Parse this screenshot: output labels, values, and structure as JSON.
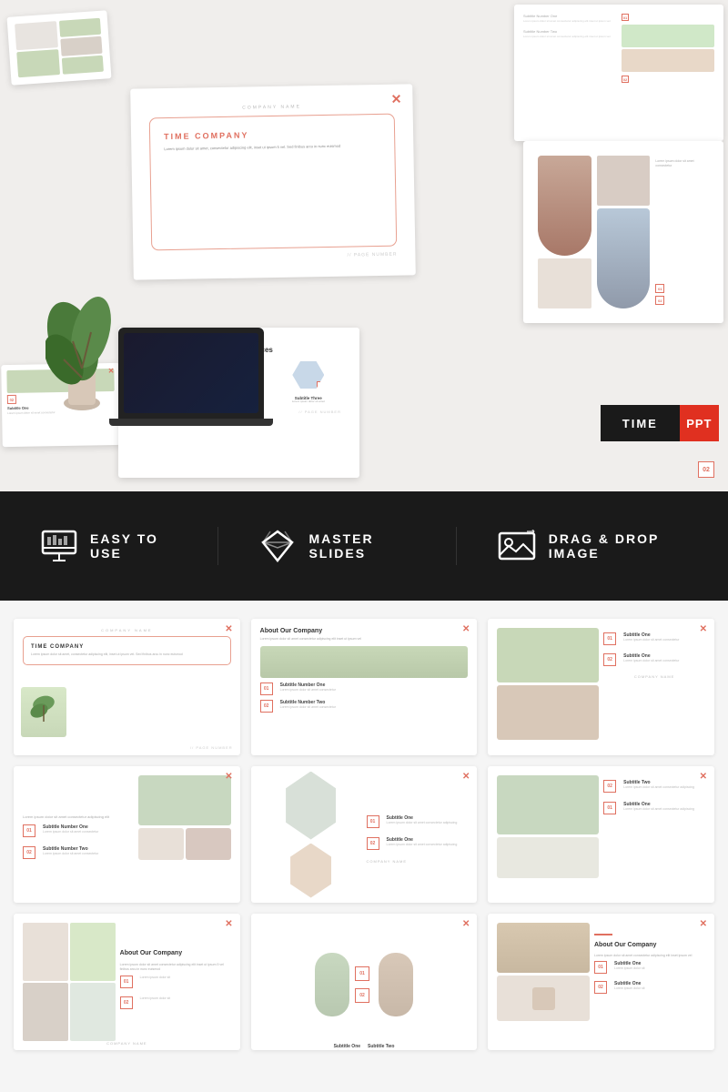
{
  "preview": {
    "company_name": "COMPANY NAME",
    "close_x": "✕",
    "title_line1": "TIME",
    "title_line2": "COMPANY",
    "body_placeholder": "Lorem ipsum dolor sit amet, consectetur adipiscing elit, inset ut ipsum 5 vel. Sed finibus arcu in nunc euismod",
    "page_number_label": "// PAGE NUMBER",
    "about_services": "About Our Services",
    "subtitle_one": "Subtitle One",
    "subtitle_two": "Subtitle Two",
    "subtitle_three": "Subtitle Three",
    "num_01": "01",
    "num_02": "02",
    "num_03": "03",
    "time_label": "TIME",
    "ppt_label": "PPT"
  },
  "features": [
    {
      "id": "easy-to-use",
      "icon": "monitor",
      "label": "EASY TO USE"
    },
    {
      "id": "master-slides",
      "icon": "diamond",
      "label": "MASTER SLIDES"
    },
    {
      "id": "drag-drop",
      "icon": "image",
      "label": "DRAG & DROP IMAGE"
    }
  ],
  "grid_slides": [
    {
      "id": "slide-1",
      "type": "title",
      "title": "TIME COMPANY",
      "has_inner_box": true,
      "has_close": true,
      "has_page_num": true
    },
    {
      "id": "slide-2",
      "type": "about",
      "title": "About Our Company",
      "has_close": true,
      "items": [
        "01",
        "02"
      ]
    },
    {
      "id": "slide-3",
      "type": "numbered",
      "has_close": true,
      "items": [
        "01",
        "02"
      ]
    },
    {
      "id": "slide-4",
      "type": "numbered-plain",
      "has_close": true,
      "items": [
        "01",
        "02"
      ]
    },
    {
      "id": "slide-5",
      "type": "shapes",
      "has_close": true,
      "items": [
        "01",
        "02"
      ]
    },
    {
      "id": "slide-6",
      "type": "numbered-right",
      "has_close": true,
      "items": [
        "02",
        "01"
      ]
    },
    {
      "id": "slide-7",
      "type": "about-small",
      "title": "About Our Company",
      "has_close": true
    },
    {
      "id": "slide-8",
      "type": "plant-center",
      "has_close": true,
      "items": [
        "01",
        "02"
      ]
    },
    {
      "id": "slide-9",
      "type": "about-warm",
      "title": "About Our Company",
      "has_close": true,
      "items": [
        "01",
        "02"
      ]
    }
  ],
  "colors": {
    "accent": "#e07060",
    "dark": "#1a1a1a",
    "light_gray": "#f5f5f5",
    "white": "#ffffff"
  }
}
